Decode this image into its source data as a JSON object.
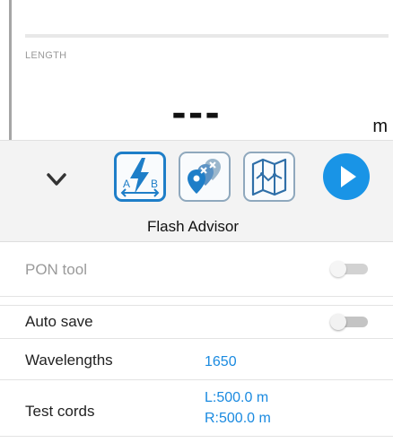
{
  "measurement": {
    "label": "LENGTH",
    "value": "---",
    "unit": "m"
  },
  "toolbar": {
    "caption": "Flash Advisor",
    "flash_badge_a": "A",
    "flash_badge_b": "B",
    "icons": [
      "chevron-down-icon",
      "flash-advisor-icon",
      "location-pins-icon",
      "fiber-map-icon",
      "play-icon"
    ],
    "accent_color": "#1e7ec8",
    "play_color": "#1994e6"
  },
  "settings": [
    {
      "label": "PON tool",
      "type": "toggle",
      "enabled": false,
      "disabled": true
    },
    {
      "label": "Auto save",
      "type": "toggle",
      "enabled": false,
      "disabled": false
    },
    {
      "label": "Wavelengths",
      "type": "value",
      "value": "1650"
    },
    {
      "label": "Test cords",
      "type": "value",
      "value_left": "L:500.0 m",
      "value_right": "R:500.0 m"
    }
  ],
  "colors": {
    "value_text": "#1a8ae0",
    "disabled_text": "#9a9a9a"
  }
}
